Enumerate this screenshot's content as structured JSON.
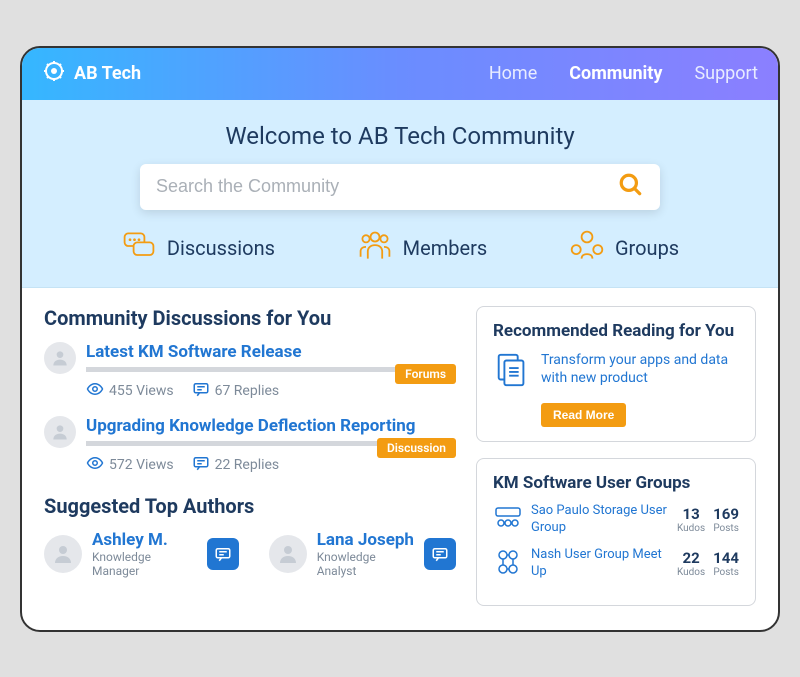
{
  "brand": "AB Tech",
  "nav": {
    "home": "Home",
    "community": "Community",
    "support": "Support"
  },
  "hero": {
    "title": "Welcome to AB Tech Community"
  },
  "search": {
    "placeholder": "Search the Community"
  },
  "tabs": {
    "discussions": "Discussions",
    "members": "Members",
    "groups": "Groups"
  },
  "discussions": {
    "heading": "Community Discussions for You",
    "items": [
      {
        "title": "Latest KM Software Release",
        "views": "455 Views",
        "replies": "67 Replies",
        "badge": "Forums"
      },
      {
        "title": "Upgrading Knowledge Deflection Reporting",
        "views": "572 Views",
        "replies": "22 Replies",
        "badge": "Discussion"
      }
    ]
  },
  "authors": {
    "heading": "Suggested Top Authors",
    "items": [
      {
        "name": "Ashley M.",
        "role": "Knowledge Manager"
      },
      {
        "name": "Lana Joseph",
        "role": "Knowledge Analyst"
      }
    ]
  },
  "recommended": {
    "heading": "Recommended Reading for You",
    "text": "Transform your apps and data with new product",
    "button": "Read More"
  },
  "groups": {
    "heading": "KM Software User Groups",
    "items": [
      {
        "name": "Sao Paulo Storage User Group",
        "kudos": "13",
        "posts": "169"
      },
      {
        "name": "Nash User Group Meet Up",
        "kudos": "22",
        "posts": "144"
      }
    ],
    "labels": {
      "kudos": "Kudos",
      "posts": "Posts"
    }
  }
}
